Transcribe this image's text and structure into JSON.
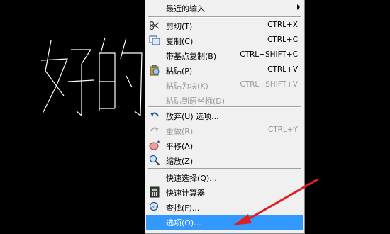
{
  "menu": {
    "items": [
      {
        "label": "最近的输入",
        "shortcut": "",
        "icon": "none",
        "disabled": false,
        "submenu": true
      },
      {
        "label": "剪切(T)",
        "shortcut": "CTRL+X",
        "icon": "scissors-icon",
        "disabled": false
      },
      {
        "label": "复制(C)",
        "shortcut": "CTRL+C",
        "icon": "copy-icon",
        "disabled": false
      },
      {
        "label": "带基点复制(B)",
        "shortcut": "CTRL+SHIFT+C",
        "icon": "none",
        "disabled": false
      },
      {
        "label": "粘贴(P)",
        "shortcut": "CTRL+V",
        "icon": "paste-icon",
        "disabled": false
      },
      {
        "label": "粘贴为块(K)",
        "shortcut": "CTRL+SHIFT+V",
        "icon": "none",
        "disabled": true
      },
      {
        "label": "粘贴到原坐标(D)",
        "shortcut": "",
        "icon": "none",
        "disabled": true
      },
      {
        "label": "放弃(U) 选项...",
        "shortcut": "",
        "icon": "undo-icon",
        "disabled": false
      },
      {
        "label": "重做(R)",
        "shortcut": "CTRL+Y",
        "icon": "redo-icon",
        "disabled": true
      },
      {
        "label": "平移(A)",
        "shortcut": "",
        "icon": "pan-hand-icon",
        "disabled": false
      },
      {
        "label": "缩放(Z)",
        "shortcut": "",
        "icon": "zoom-magnifier-icon",
        "disabled": false
      },
      {
        "label": "快速选择(Q)...",
        "shortcut": "",
        "icon": "none",
        "disabled": false
      },
      {
        "label": "快速计算器",
        "shortcut": "",
        "icon": "calculator-icon",
        "disabled": false
      },
      {
        "label": "查找(F)...",
        "shortcut": "",
        "icon": "find-icon",
        "disabled": false
      },
      {
        "label": "选项(O)...",
        "shortcut": "",
        "icon": "none",
        "disabled": false,
        "selected": true
      }
    ]
  },
  "drawing": {
    "text": "好的"
  },
  "colors": {
    "highlight": "#3399ff",
    "arrow": "#e02020",
    "background": "#000000"
  }
}
